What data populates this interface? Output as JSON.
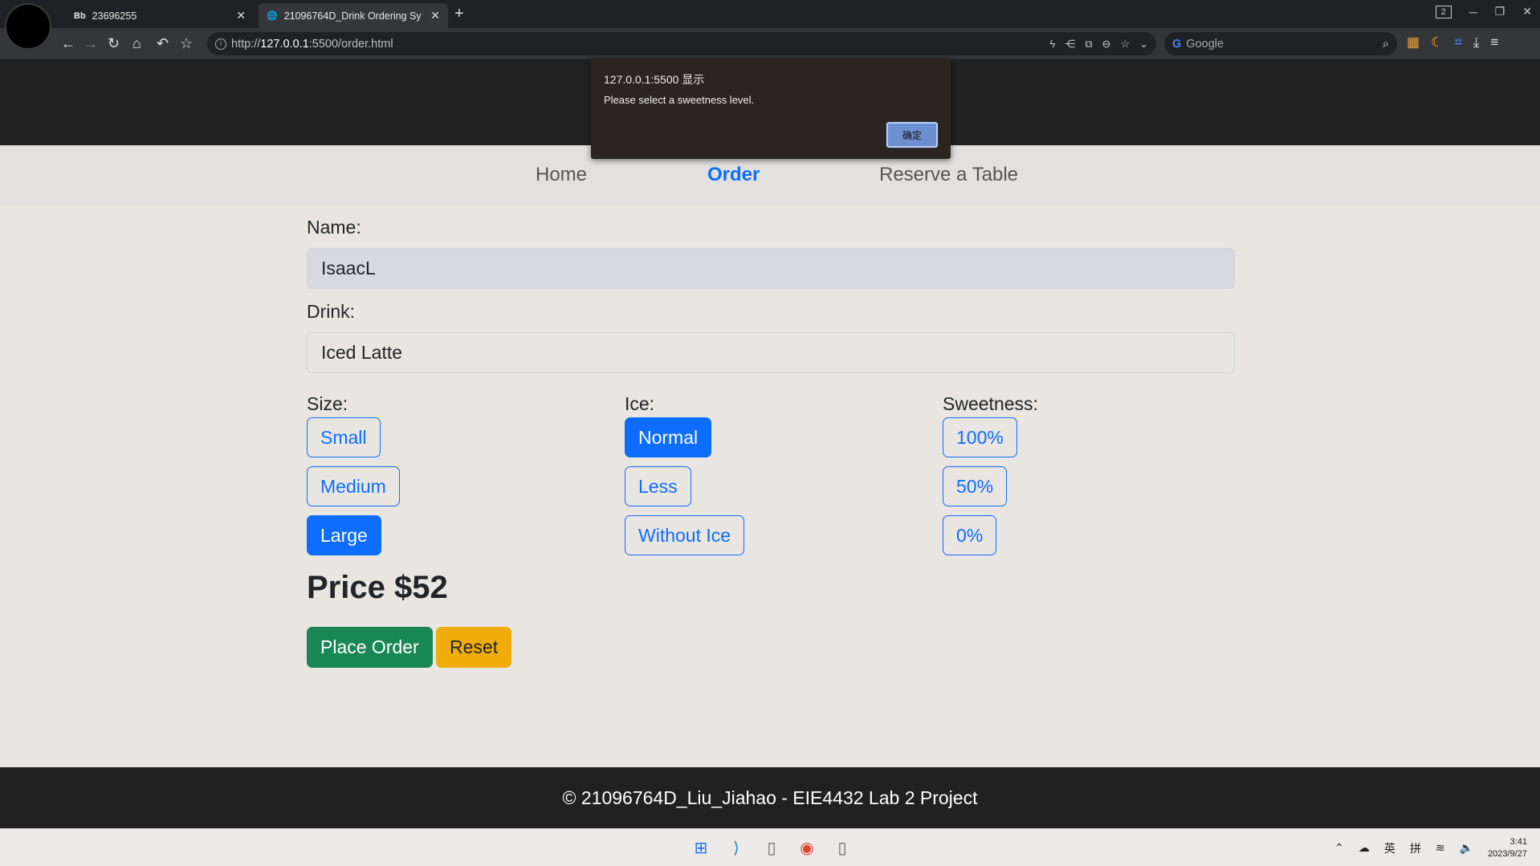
{
  "browser": {
    "tabs": [
      {
        "favicon": "Bb",
        "title": "23696255"
      },
      {
        "favicon": "globe-icon",
        "title": "21096764D_Drink Ordering Sy"
      }
    ],
    "tab_count": "2",
    "url_prefix": "http://",
    "url_host": "127.0.0.1",
    "url_rest": ":5500/order.html",
    "search_placeholder": "Google"
  },
  "site": {
    "title": "Drink Ordering System",
    "nav": {
      "home": "Home",
      "order": "Order",
      "reserve": "Reserve a Table"
    },
    "active_nav": "Order"
  },
  "form": {
    "name_label": "Name:",
    "name_value": "IsaacL",
    "drink_label": "Drink:",
    "drink_value": "Iced Latte",
    "size_label": "Size:",
    "size_options": [
      "Small",
      "Medium",
      "Large"
    ],
    "size_selected": "Large",
    "ice_label": "Ice:",
    "ice_options": [
      "Normal",
      "Less",
      "Without Ice"
    ],
    "ice_selected": "Normal",
    "sweet_label": "Sweetness:",
    "sweet_options": [
      "100%",
      "50%",
      "0%"
    ],
    "sweet_selected": null,
    "price": "Price $52",
    "place_order": "Place Order",
    "reset": "Reset"
  },
  "footer": "© 21096764D_Liu_Jiahao - EIE4432 Lab 2 Project",
  "alert": {
    "title": "127.0.0.1:5500 显示",
    "message": "Please select a sweetness level.",
    "ok": "确定"
  },
  "taskbar": {
    "time": "3:41",
    "date": "2023/9/27",
    "ime1": "英",
    "ime2": "拼"
  },
  "colors": {
    "primary": "#0d6efd",
    "success": "#198754",
    "warning": "#f0ac0a",
    "dark": "#212121"
  }
}
